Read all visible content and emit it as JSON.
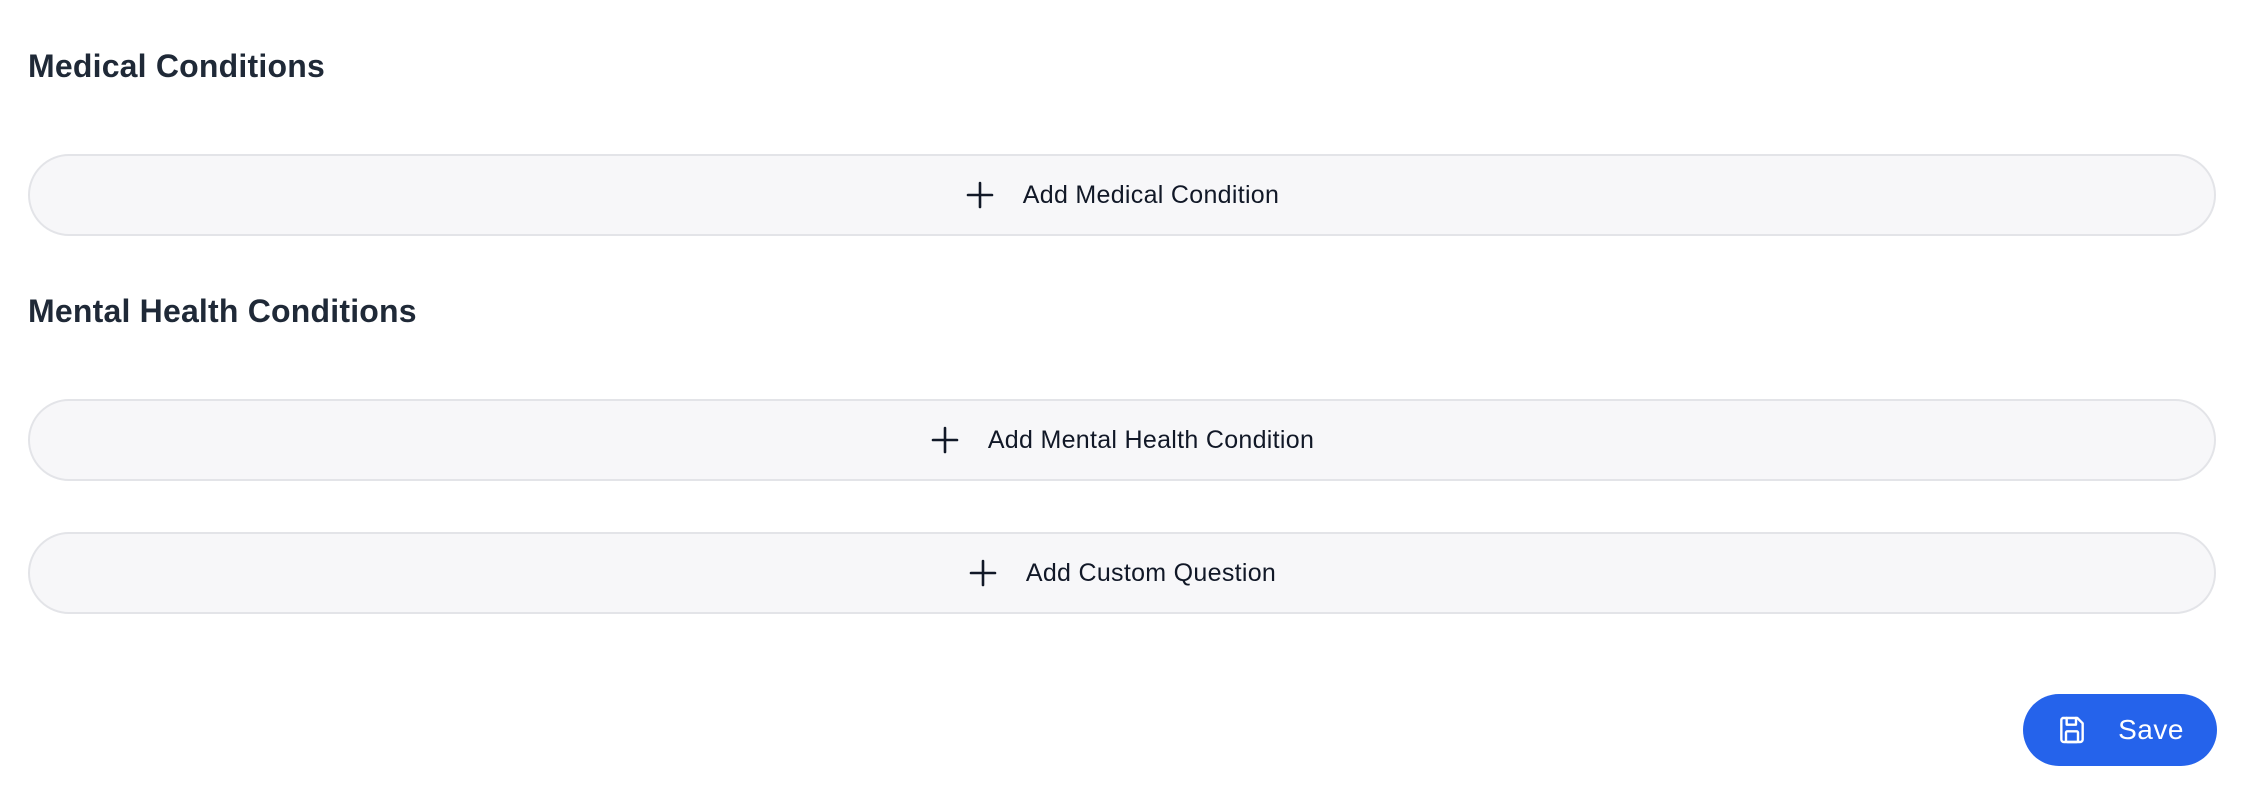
{
  "sections": {
    "medical": {
      "title": "Medical Conditions",
      "add_label": "Add Medical Condition"
    },
    "mental_health": {
      "title": "Mental Health Conditions",
      "add_label": "Add Mental Health Condition"
    },
    "custom": {
      "add_label": "Add Custom Question"
    }
  },
  "actions": {
    "save_label": "Save"
  },
  "icons": {
    "add": "plus-icon",
    "save": "floppy-disk-icon"
  },
  "colors": {
    "primary": "#2563eb",
    "button_bg": "#f7f7f9",
    "button_border": "#e3e4e8",
    "heading": "#1f2937"
  }
}
